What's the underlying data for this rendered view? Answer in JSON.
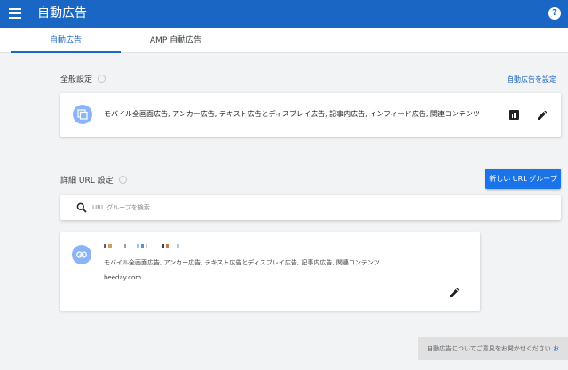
{
  "header": {
    "title": "自動広告"
  },
  "tabs": [
    {
      "label": "自動広告",
      "active": true
    },
    {
      "label": "AMP 自動広告",
      "active": false
    }
  ],
  "general": {
    "label": "全般設定",
    "settings_link": "自動広告を設定",
    "description": "モバイル全画面広告, アンカー広告, テキスト広告とディスプレイ広告, 記事内広告, インフィード広告, 関連コンテンツ"
  },
  "url_settings": {
    "label": "詳細 URL 設定",
    "new_button": "新しい URL グループ",
    "search_placeholder": "URL グループを検索"
  },
  "url_group": {
    "description": "モバイル全画面広告, アンカー広告, テキスト広告とディスプレイ広告, 記事内広告, 関連コンテンツ",
    "domain": "heeday.com"
  },
  "feedback": {
    "text": "自動広告についてご意見をお聞かせください",
    "more": "お"
  },
  "colors": {
    "appbar": "#1a66c4",
    "primary_button": "#1a73e8",
    "avatar": "#8ab4f8"
  }
}
